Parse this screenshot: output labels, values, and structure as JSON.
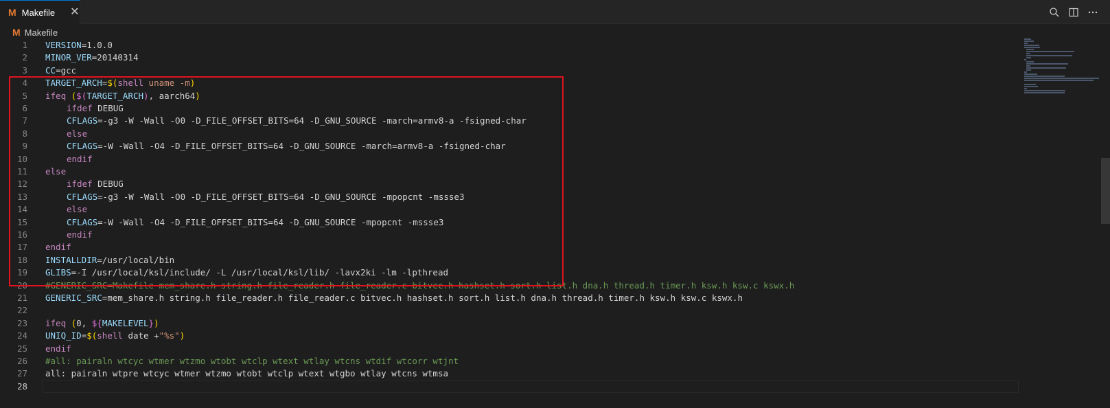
{
  "tab": {
    "icon_letter": "M",
    "title": "Makefile",
    "close": "✕"
  },
  "breadcrumb": {
    "icon_letter": "M",
    "label": "Makefile"
  },
  "actions": [
    "search-icon",
    "split-editor-icon",
    "more-actions-icon"
  ],
  "colors": {
    "accent": "#0078d4",
    "highlight_border": "#e0131e",
    "makefile_icon": "#e37933"
  },
  "editor": {
    "lines": [
      {
        "n": "1",
        "t": [
          [
            "VERSION",
            "v"
          ],
          [
            "=1.0.0",
            ""
          ]
        ]
      },
      {
        "n": "2",
        "t": [
          [
            "MINOR_VER",
            "v"
          ],
          [
            "=20140314",
            ""
          ]
        ]
      },
      {
        "n": "3",
        "t": [
          [
            "CC",
            "v"
          ],
          [
            "=gcc",
            ""
          ]
        ]
      },
      {
        "n": "4",
        "t": [
          [
            "TARGET_ARCH",
            "v"
          ],
          [
            "=",
            ""
          ],
          [
            "$(",
            "y"
          ],
          [
            "shell ",
            "k"
          ],
          [
            "uname -m",
            "s"
          ],
          [
            ")",
            "y"
          ]
        ]
      },
      {
        "n": "5",
        "t": [
          [
            "ifeq ",
            "k"
          ],
          [
            "(",
            "y"
          ],
          [
            "$(",
            "p"
          ],
          [
            "TARGET_ARCH",
            "v"
          ],
          [
            ")",
            "p"
          ],
          [
            ", aarch64",
            ""
          ],
          [
            ")",
            "y"
          ]
        ]
      },
      {
        "n": "6",
        "i": true,
        "t": [
          [
            "ifdef ",
            "k"
          ],
          [
            "DEBUG",
            ""
          ]
        ]
      },
      {
        "n": "7",
        "i": true,
        "t": [
          [
            "CFLAGS",
            "v"
          ],
          [
            "=-g3 -W -Wall -O0 -D_FILE_OFFSET_BITS=64 -D_GNU_SOURCE -march=armv8-a -fsigned-char",
            ""
          ]
        ]
      },
      {
        "n": "8",
        "i": true,
        "t": [
          [
            "else",
            "k"
          ]
        ]
      },
      {
        "n": "9",
        "i": true,
        "t": [
          [
            "CFLAGS",
            "v"
          ],
          [
            "=-W -Wall -O4 -D_FILE_OFFSET_BITS=64 -D_GNU_SOURCE -march=armv8-a -fsigned-char",
            ""
          ]
        ]
      },
      {
        "n": "10",
        "i": true,
        "t": [
          [
            "endif",
            "k"
          ]
        ]
      },
      {
        "n": "11",
        "t": [
          [
            "else",
            "k"
          ]
        ]
      },
      {
        "n": "12",
        "i": true,
        "t": [
          [
            "ifdef ",
            "k"
          ],
          [
            "DEBUG",
            ""
          ]
        ]
      },
      {
        "n": "13",
        "i": true,
        "t": [
          [
            "CFLAGS",
            "v"
          ],
          [
            "=-g3 -W -Wall -O0 -D_FILE_OFFSET_BITS=64 -D_GNU_SOURCE -mpopcnt -mssse3",
            ""
          ]
        ]
      },
      {
        "n": "14",
        "i": true,
        "t": [
          [
            "else",
            "k"
          ]
        ]
      },
      {
        "n": "15",
        "i": true,
        "t": [
          [
            "CFLAGS",
            "v"
          ],
          [
            "=-W -Wall -O4 -D_FILE_OFFSET_BITS=64 -D_GNU_SOURCE -mpopcnt -mssse3",
            ""
          ]
        ]
      },
      {
        "n": "16",
        "i": true,
        "t": [
          [
            "endif",
            "k"
          ]
        ]
      },
      {
        "n": "17",
        "t": [
          [
            "endif",
            "k"
          ]
        ]
      },
      {
        "n": "18",
        "t": [
          [
            "INSTALLDIR",
            "v"
          ],
          [
            "=/usr/local/bin",
            ""
          ]
        ]
      },
      {
        "n": "19",
        "t": [
          [
            "GLIBS",
            "v"
          ],
          [
            "=-I /usr/local/ksl/include/ -L /usr/local/ksl/lib/ -lavx2ki -lm -lpthread",
            ""
          ]
        ]
      },
      {
        "n": "20",
        "t": [
          [
            "#GENERIC_SRC=Makefile mem_share.h string.h file_reader.h file_reader.c bitvec.h hashset.h sort.h list.h dna.h thread.h timer.h ksw.h ksw.c kswx.h",
            "c"
          ]
        ]
      },
      {
        "n": "21",
        "t": [
          [
            "GENERIC_SRC",
            "v"
          ],
          [
            "=mem_share.h string.h file_reader.h file_reader.c bitvec.h hashset.h sort.h list.h dna.h thread.h timer.h ksw.h ksw.c kswx.h",
            ""
          ]
        ]
      },
      {
        "n": "22",
        "t": []
      },
      {
        "n": "23",
        "t": [
          [
            "ifeq ",
            "k"
          ],
          [
            "(",
            "y"
          ],
          [
            "0, ",
            ""
          ],
          [
            "${",
            "p"
          ],
          [
            "MAKELEVEL",
            "v"
          ],
          [
            "}",
            "p"
          ],
          [
            ")",
            "y"
          ]
        ]
      },
      {
        "n": "24",
        "t": [
          [
            "UNIQ_ID",
            "v"
          ],
          [
            "=",
            ""
          ],
          [
            "$(",
            "y"
          ],
          [
            "shell ",
            "k"
          ],
          [
            "date +",
            ""
          ],
          [
            "\"%s\"",
            "s"
          ],
          [
            ")",
            "y"
          ]
        ]
      },
      {
        "n": "25",
        "t": [
          [
            "endif",
            "k"
          ]
        ]
      },
      {
        "n": "26",
        "t": [
          [
            "#all: pairaln wtcyc wtmer wtzmo wtobt wtclp wtext wtlay wtcns wtdif wtcorr wtjnt",
            "c"
          ]
        ]
      },
      {
        "n": "27",
        "t": [
          [
            "all",
            ""
          ],
          [
            ": pairaln wtpre wtcyc wtmer wtzmo wtobt wtclp wtext wtgbo wtlay wtcns wtmsa",
            ""
          ]
        ]
      },
      {
        "n": "28",
        "t": [],
        "active": true
      }
    ]
  }
}
